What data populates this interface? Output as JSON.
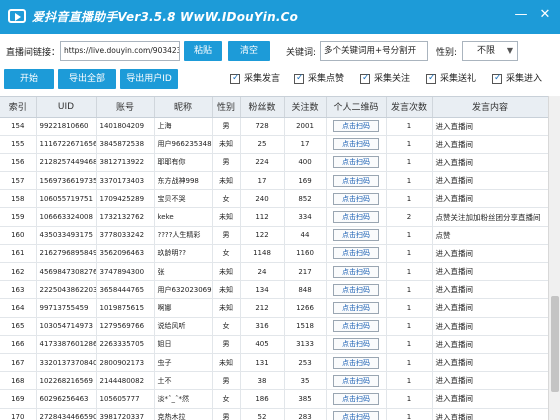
{
  "app": {
    "title": "爱抖音直播助手Ver3.5.8 WwW.IDouYin.Co"
  },
  "controls": {
    "room_link_label": "直播间链接：",
    "room_link_value": "https://live.douyin.com/90342324",
    "paste_label": "粘贴",
    "clear_label": "清空",
    "keyword_label": "关键词:",
    "keyword_value": "多个关键词用+号分割开",
    "gender_label": "性别:",
    "gender_value": "不限",
    "start_label": "开始",
    "export_all_label": "导出全部",
    "export_uid_label": "导出用户ID"
  },
  "checkboxes": [
    {
      "label": "采集发言",
      "checked": true
    },
    {
      "label": "采集点赞",
      "checked": true
    },
    {
      "label": "采集关注",
      "checked": true
    },
    {
      "label": "采集送礼",
      "checked": true
    },
    {
      "label": "采集进入",
      "checked": true
    }
  ],
  "table": {
    "headers": [
      "索引",
      "UID",
      "账号",
      "昵称",
      "性别",
      "粉丝数",
      "关注数",
      "个人二维码",
      "发言次数",
      "发言内容"
    ],
    "scan_label": "点击扫码",
    "rows": [
      [
        "154",
        "99221810660",
        "1401804209",
        "上海",
        "男",
        "728",
        "2001",
        "1",
        "进入直播间"
      ],
      [
        "155",
        "1116722671656",
        "3845872538",
        "用户966235348",
        "未知",
        "25",
        "17",
        "1",
        "进入直播间"
      ],
      [
        "156",
        "2128257449468",
        "3812713922",
        "耶耶有你",
        "男",
        "224",
        "400",
        "1",
        "进入直播间"
      ],
      [
        "157",
        "1569736619735",
        "3370173403",
        "东方战神998",
        "未知",
        "17",
        "169",
        "1",
        "进入直播间"
      ],
      [
        "158",
        "106055719751",
        "1709425289",
        "宝贝不哭",
        "女",
        "240",
        "852",
        "1",
        "进入直播间"
      ],
      [
        "159",
        "106663324008",
        "1732132762",
        "keke",
        "未知",
        "112",
        "334",
        "2",
        "点赞关注加加粉丝团分享直播间"
      ],
      [
        "160",
        "435033493175",
        "3778033242",
        "????人生精彩",
        "男",
        "122",
        "44",
        "1",
        "点赞"
      ],
      [
        "161",
        "2162796895849",
        "3562096463",
        "玖龄明??",
        "女",
        "1148",
        "1160",
        "1",
        "进入直播间"
      ],
      [
        "162",
        "4569847308276",
        "3747894300",
        "张",
        "未知",
        "24",
        "217",
        "1",
        "进入直播间"
      ],
      [
        "163",
        "2225043862203",
        "3658444765",
        "用户632023069",
        "未知",
        "134",
        "848",
        "1",
        "进入直播间"
      ],
      [
        "164",
        "99713755459",
        "1019875615",
        "啊娜",
        "未知",
        "212",
        "1266",
        "1",
        "进入直播间"
      ],
      [
        "165",
        "103054714973",
        "1279569766",
        "说给风听",
        "女",
        "316",
        "1518",
        "1",
        "进入直播间"
      ],
      [
        "166",
        "4173387601286",
        "2263335705",
        "姐日",
        "男",
        "405",
        "3133",
        "1",
        "进入直播间"
      ],
      [
        "167",
        "3320137370840",
        "2800902173",
        "虫子",
        "未知",
        "131",
        "253",
        "1",
        "进入直播间"
      ],
      [
        "168",
        "102268216569",
        "2144480082",
        "土不",
        "男",
        "38",
        "35",
        "1",
        "进入直播间"
      ],
      [
        "169",
        "60296256463",
        "105605777",
        "淡*ˆ_ˆ*然",
        "女",
        "186",
        "385",
        "1",
        "进入直播间"
      ],
      [
        "170",
        "2728434466590",
        "3981720337",
        "克热木拉",
        "男",
        "52",
        "283",
        "1",
        "进入直播间"
      ]
    ]
  }
}
